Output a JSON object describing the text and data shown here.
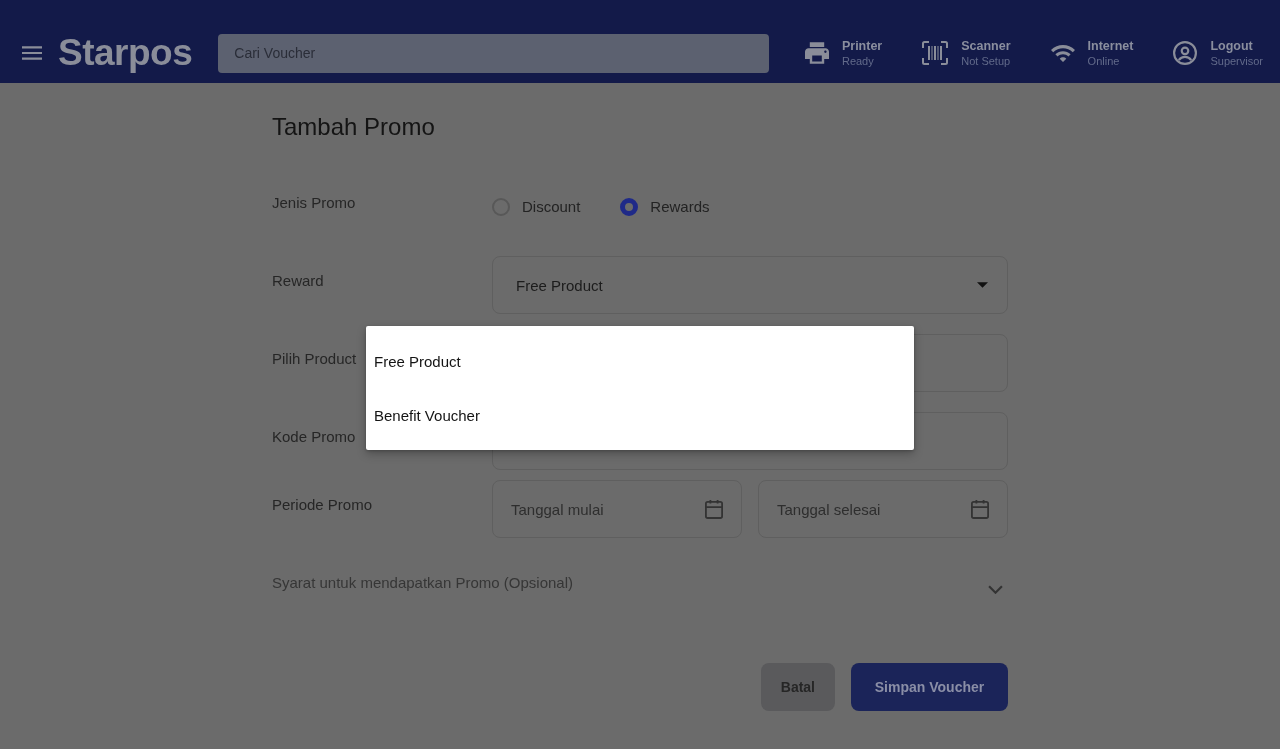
{
  "header": {
    "logo": "Starpos",
    "search": {
      "placeholder": "Cari Voucher"
    },
    "status_items": [
      {
        "kind": "printer",
        "title": "Printer",
        "subtitle": "Ready"
      },
      {
        "kind": "scanner",
        "title": "Scanner",
        "subtitle": "Not Setup"
      },
      {
        "kind": "wifi",
        "title": "Internet",
        "subtitle": "Online"
      },
      {
        "kind": "account",
        "title": "Logout",
        "subtitle": "Supervisor"
      }
    ]
  },
  "form": {
    "title": "Tambah Promo",
    "rows": [
      {
        "kind": "radio",
        "label": "Jenis Promo",
        "options": [
          {
            "label": "Discount",
            "selected": false
          },
          {
            "label": "Rewards",
            "selected": true
          }
        ]
      },
      {
        "kind": "select",
        "label": "Reward",
        "value": "Free Product"
      },
      {
        "kind": "field",
        "label": "Pilih Product"
      },
      {
        "kind": "field",
        "label": "Kode Promo"
      },
      {
        "kind": "dates",
        "label": "Periode Promo",
        "fields": [
          {
            "placeholder": "Tanggal mulai"
          },
          {
            "placeholder": "Tanggal selesai"
          }
        ]
      }
    ],
    "conditions": {
      "label": "Syarat untuk mendapatkan Promo (Opsional)",
      "expanded": false
    },
    "buttons": [
      {
        "kind": "secondary",
        "label": "Batal"
      },
      {
        "kind": "primary",
        "label": "Simpan Voucher"
      }
    ]
  },
  "dropdown_menu": {
    "items": [
      {
        "label": "Free Product"
      },
      {
        "label": "Benefit Voucher"
      }
    ]
  }
}
